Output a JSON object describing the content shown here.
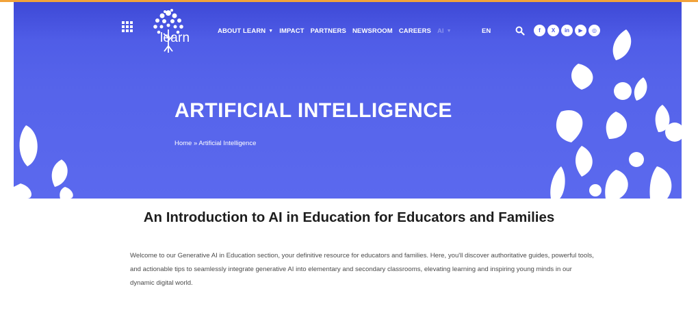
{
  "colors": {
    "hero": "#5563ea",
    "accent": "#f2a33b",
    "text": "#1d1d1d"
  },
  "header": {
    "logo_text": "learn",
    "nav": [
      {
        "label": "ABOUT LEARN",
        "caret": "▼"
      },
      {
        "label": "IMPACT"
      },
      {
        "label": "PARTNERS"
      },
      {
        "label": "NEWSROOM"
      },
      {
        "label": "CAREERS"
      },
      {
        "label": "AI",
        "caret": "▼"
      }
    ],
    "language": "EN",
    "icons": [
      "apps-grid-icon",
      "search-icon"
    ],
    "socials": [
      {
        "name": "facebook-icon",
        "glyph": "f"
      },
      {
        "name": "x-icon",
        "glyph": "X"
      },
      {
        "name": "linkedin-icon",
        "glyph": "in"
      },
      {
        "name": "youtube-icon",
        "glyph": "▶"
      },
      {
        "name": "instagram-icon",
        "glyph": "◎"
      }
    ]
  },
  "hero": {
    "title": "ARTIFICIAL  INTELLIGENCE",
    "breadcrumb": {
      "home": "Home",
      "separator": " » ",
      "current": "Artificial Intelligence"
    }
  },
  "main": {
    "heading": "An Introduction to AI in Education for Educators and Families",
    "intro": "Welcome to our Generative AI in Education section, your definitive resource for educators and families. Here, you'll discover authoritative guides, powerful tools, and actionable tips to seamlessly integrate generative AI into elementary and secondary classrooms, elevating learning and inspiring young minds in our dynamic digital world."
  }
}
